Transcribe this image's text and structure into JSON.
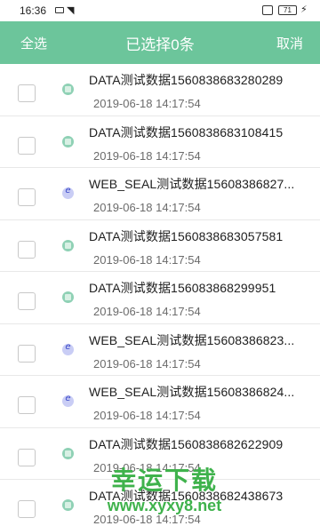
{
  "status_bar": {
    "time": "16:36",
    "battery_text": "71"
  },
  "app_bar": {
    "select_all_label": "全选",
    "title": "已选择0条",
    "cancel_label": "取消",
    "background_color": "#6cc59b"
  },
  "items": [
    {
      "type": "data",
      "icon": "data-type-icon",
      "title": "DATA测试数据1560838683280289",
      "date": "2019-06-18 14:17:54",
      "checked": false
    },
    {
      "type": "data",
      "icon": "data-type-icon",
      "title": "DATA测试数据1560838683108415",
      "date": "2019-06-18 14:17:54",
      "checked": false
    },
    {
      "type": "web",
      "icon": "web-type-icon",
      "title": "WEB_SEAL测试数据15608386827...",
      "date": "2019-06-18 14:17:54",
      "checked": false
    },
    {
      "type": "data",
      "icon": "data-type-icon",
      "title": "DATA测试数据1560838683057581",
      "date": "2019-06-18 14:17:54",
      "checked": false
    },
    {
      "type": "data",
      "icon": "data-type-icon",
      "title": "DATA测试数据156083868299951",
      "date": "2019-06-18 14:17:54",
      "checked": false
    },
    {
      "type": "web",
      "icon": "web-type-icon",
      "title": "WEB_SEAL测试数据15608386823...",
      "date": "2019-06-18 14:17:54",
      "checked": false
    },
    {
      "type": "web",
      "icon": "web-type-icon",
      "title": "WEB_SEAL测试数据15608386824...",
      "date": "2019-06-18 14:17:54",
      "checked": false
    },
    {
      "type": "data",
      "icon": "data-type-icon",
      "title": "DATA测试数据1560838682622909",
      "date": "2019-06-18 14:17:54",
      "checked": false
    },
    {
      "type": "data",
      "icon": "data-type-icon",
      "title": "DATA测试数据1560838682438673",
      "date": "2019-06-18 14:17:54",
      "checked": false
    }
  ],
  "watermark": {
    "line1": "幸运下载",
    "line2": "www.xyxy8.net"
  }
}
